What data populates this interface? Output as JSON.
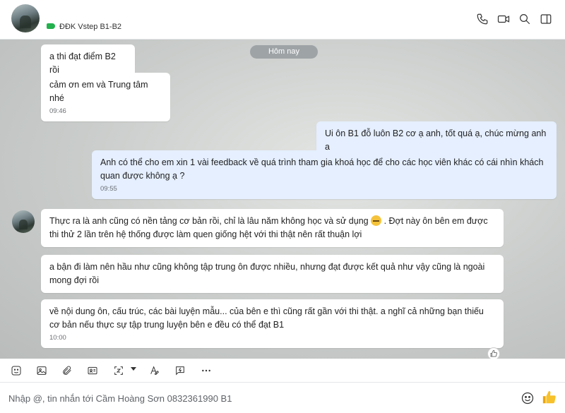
{
  "header": {
    "title": "ĐĐK Vstep B1-B2",
    "label_color": "#23b14d",
    "icons": [
      "phone-icon",
      "video-call-icon",
      "search-icon",
      "sidebar-toggle-icon"
    ]
  },
  "chat": {
    "date_separator": "Hôm nay",
    "messages": [
      {
        "direction": "in",
        "text": "a thi đạt điểm B2 rồi",
        "time": ""
      },
      {
        "direction": "in",
        "text": "cảm ơn em và Trung tâm nhé",
        "time": "09:46"
      },
      {
        "direction": "out",
        "text": "Ui ôn B1 đỗ luôn B2 cơ ạ anh, tốt quá ạ, chúc mừng anh ạ",
        "time": ""
      },
      {
        "direction": "out",
        "text": "Anh có thể cho em xin 1 vài feedback về quá trình tham gia khoá học để cho các học viên khác có cái nhìn khách quan được không ạ ?",
        "time": "09:55"
      },
      {
        "direction": "in",
        "text_before_emoji": "Thực ra là anh cũng có nền tảng cơ bản rồi, chỉ là lâu năm không học và sử dụng",
        "emoji": "grinning-face",
        "text_after_emoji": ". Đợt này ôn bên em được thi thử 2 lần trên hệ thống được làm quen giống hệt với thi thật nên rất thuận lợi",
        "time": ""
      },
      {
        "direction": "in",
        "text": "a bận đi làm nên hầu như cũng không tập trung ôn được nhiều, nhưng đạt được kết quả như vậy cũng là ngoài mong đợi rồi",
        "time": ""
      },
      {
        "direction": "in",
        "text": "về nội dung ôn, cấu trúc, các bài luyện mẫu... của bên e thì cũng rất gần với thi thật. a nghĩ cả những bạn thiếu cơ bản nếu thực sự tập trung luyện bên e đều có thể đạt B1",
        "time": "10:00"
      }
    ],
    "reaction_icon": "thumbs-up-icon",
    "outgoing_bubble_color": "#e5efff"
  },
  "toolbar": {
    "icons": [
      "sticker-icon",
      "image-icon",
      "attachment-icon",
      "contact-card-icon",
      "screenshot-icon",
      "text-format-icon",
      "urgent-message-icon",
      "more-icon"
    ]
  },
  "composer": {
    "placeholder": "Nhập @, tin nhắn tới Cầm Hoàng Sơn 0832361990 B1",
    "value": ""
  }
}
